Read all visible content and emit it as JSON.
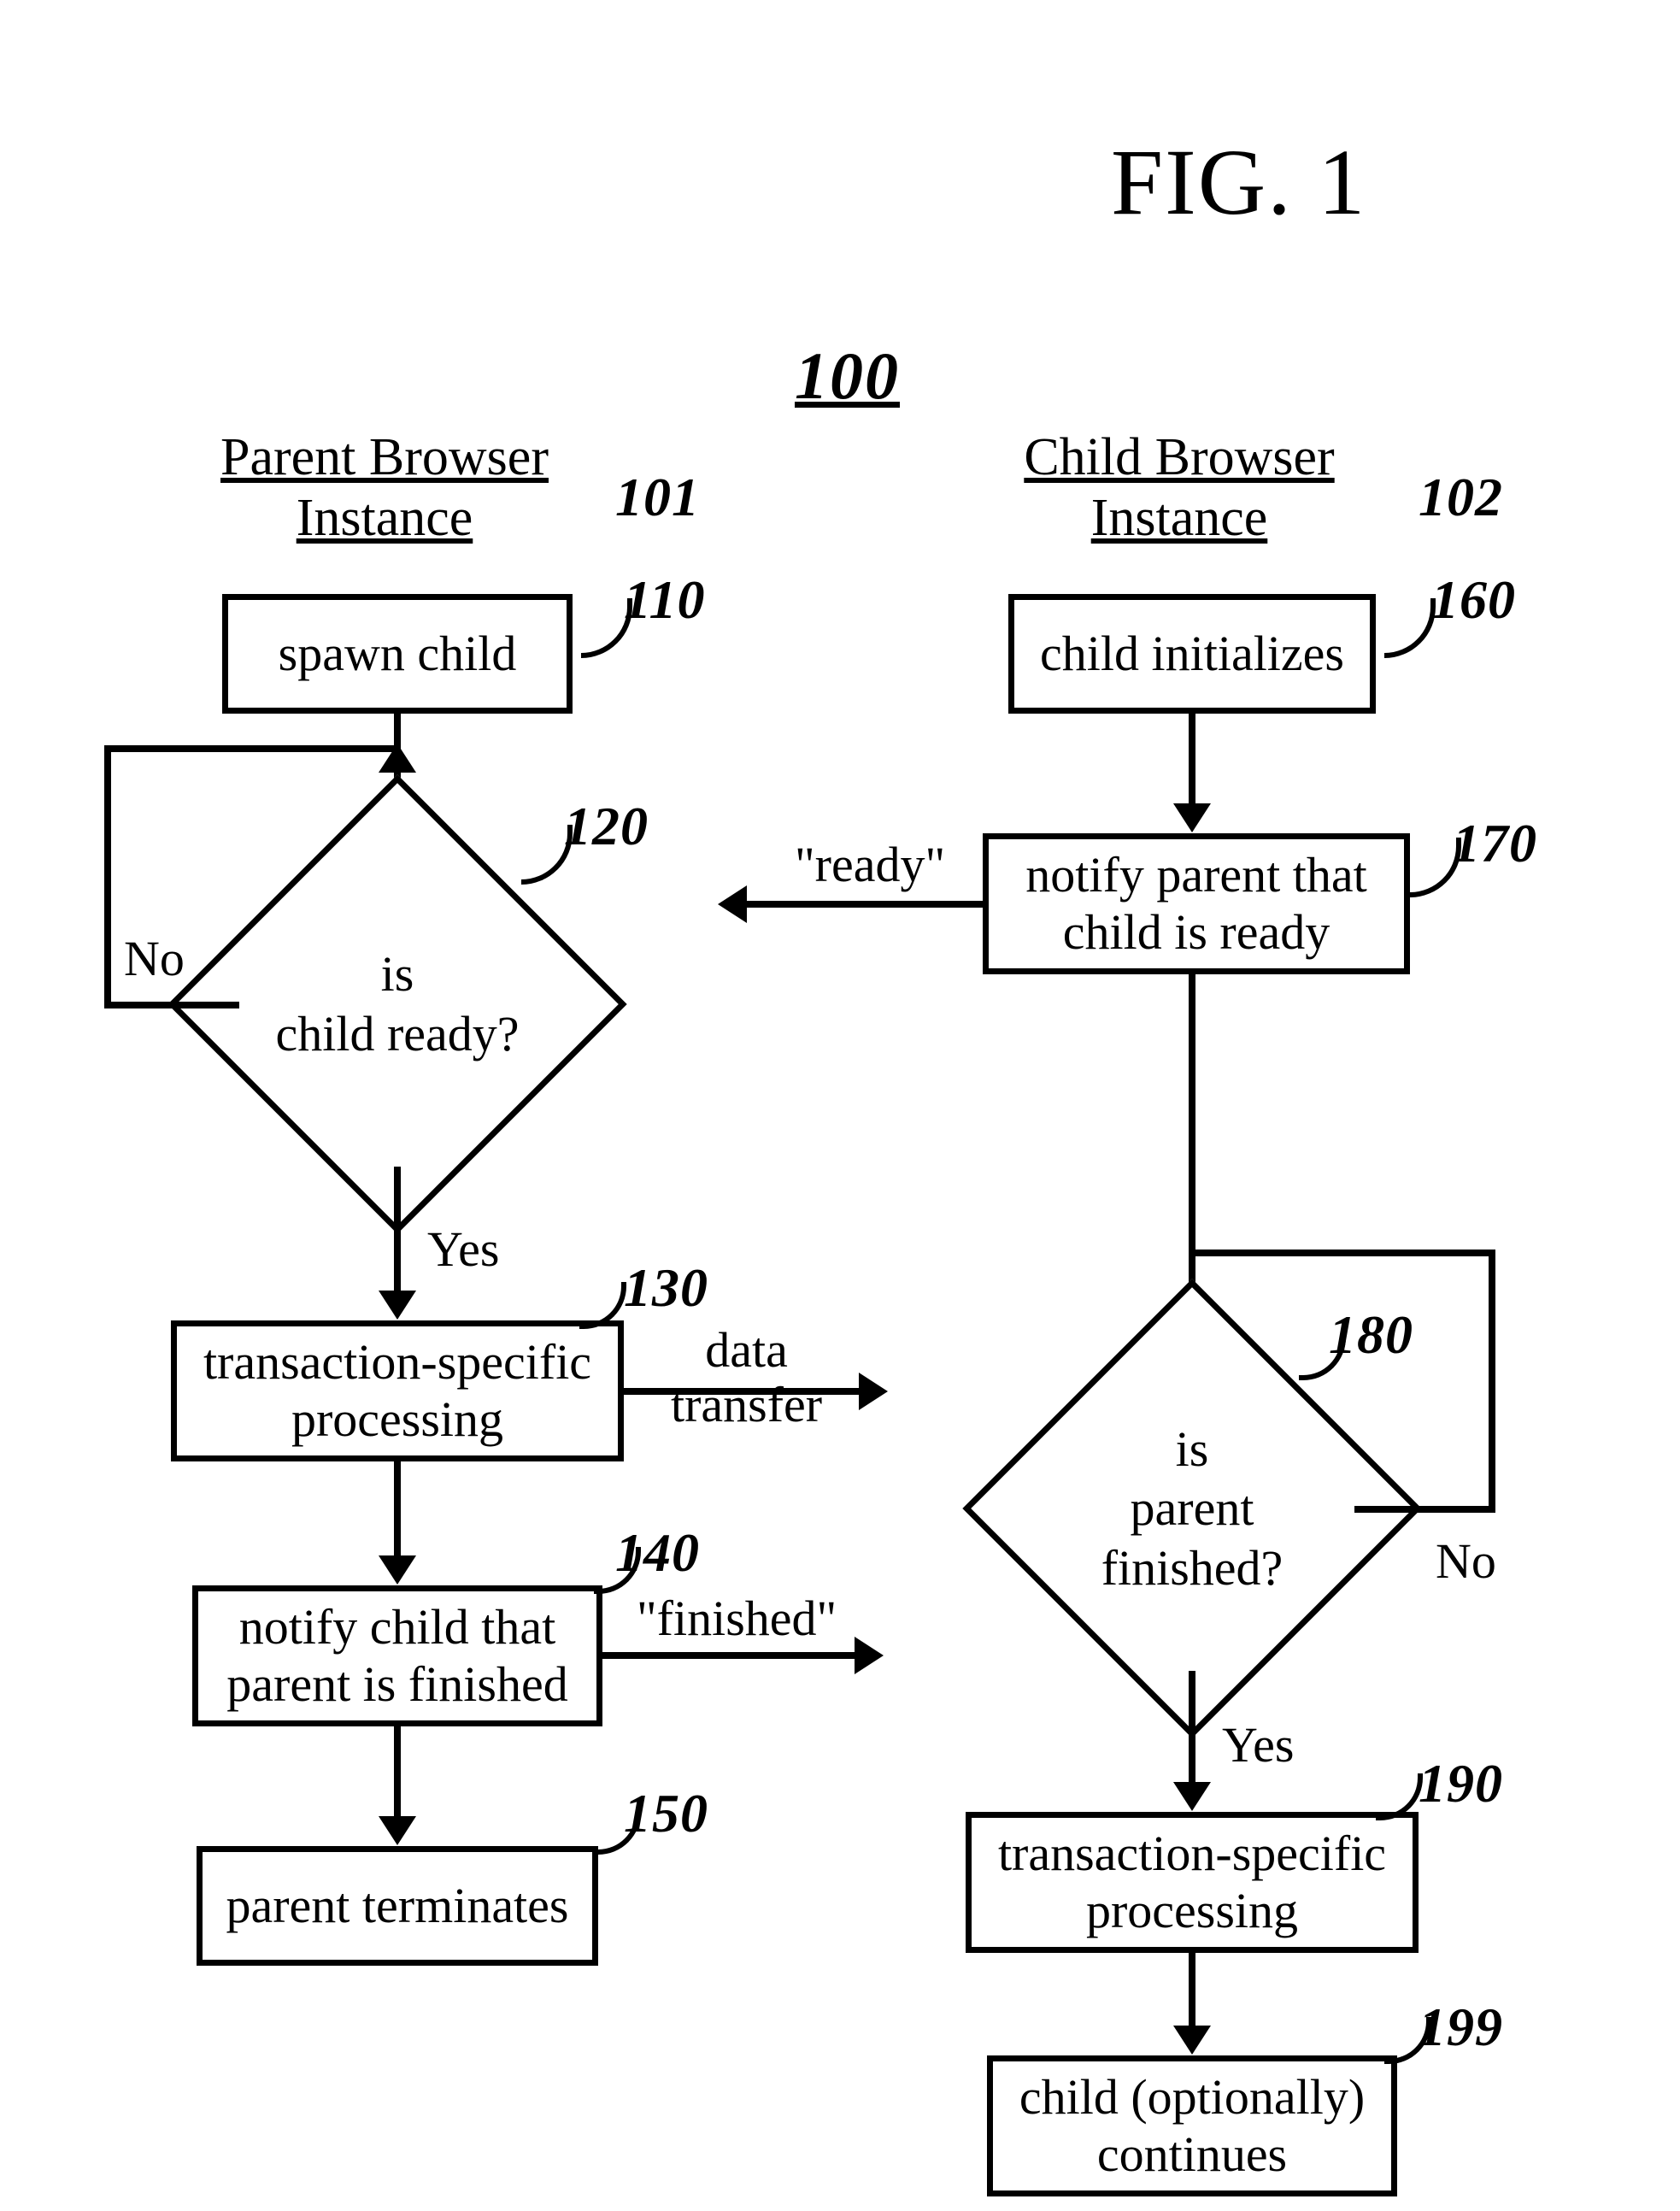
{
  "figure": {
    "title": "FIG. 1",
    "number": "100"
  },
  "columns": {
    "parent": {
      "title": "Parent Browser\nInstance",
      "ref": "101"
    },
    "child": {
      "title": "Child Browser\nInstance",
      "ref": "102"
    }
  },
  "nodes": {
    "n110": {
      "ref": "110",
      "text": "spawn child"
    },
    "n120": {
      "ref": "120",
      "text": "is\nchild ready?"
    },
    "n130": {
      "ref": "130",
      "text": "transaction-specific\nprocessing"
    },
    "n140": {
      "ref": "140",
      "text": "notify child that\nparent is finished"
    },
    "n150": {
      "ref": "150",
      "text": "parent terminates"
    },
    "n160": {
      "ref": "160",
      "text": "child initializes"
    },
    "n170": {
      "ref": "170",
      "text": "notify parent that\nchild is ready"
    },
    "n180": {
      "ref": "180",
      "text": "is\nparent\nfinished?"
    },
    "n190": {
      "ref": "190",
      "text": "transaction-specific\nprocessing"
    },
    "n199": {
      "ref": "199",
      "text": "child (optionally)\ncontinues"
    }
  },
  "edges": {
    "no": "No",
    "yes": "Yes",
    "ready": "\"ready\"",
    "data_transfer": "data\ntransfer",
    "finished": "\"finished\""
  }
}
